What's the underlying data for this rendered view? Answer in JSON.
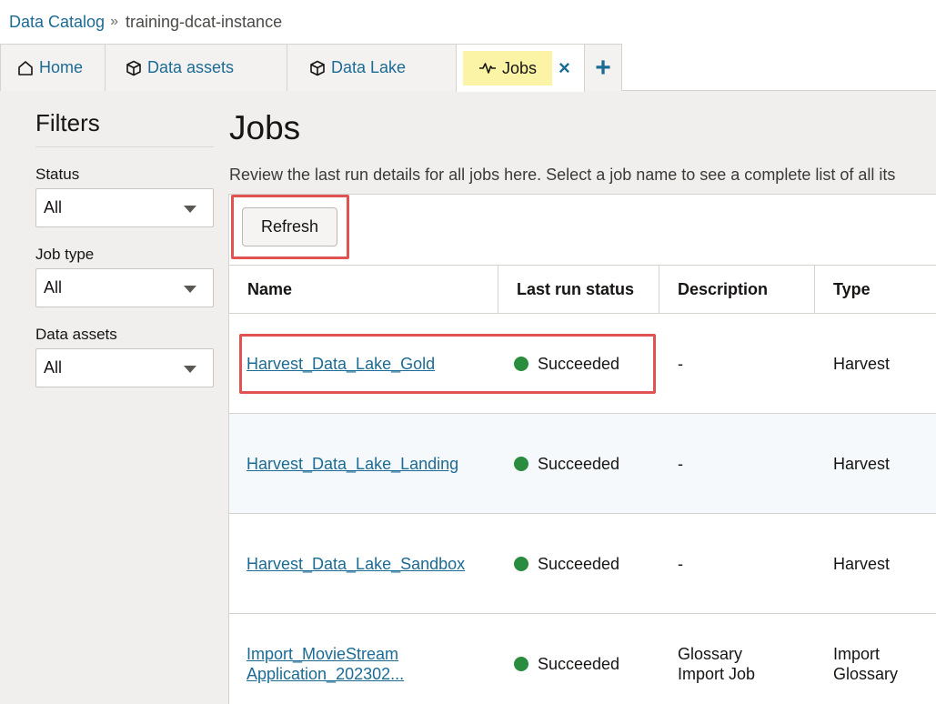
{
  "breadcrumb": {
    "root": "Data Catalog",
    "separator": "»",
    "current": "training-dcat-instance"
  },
  "tabs": {
    "home": "Home",
    "data_assets": "Data assets",
    "data_lake": "Data Lake",
    "jobs": "Jobs",
    "close_glyph": "×",
    "add_glyph": "+"
  },
  "filters": {
    "title": "Filters",
    "status_label": "Status",
    "status_value": "All",
    "job_type_label": "Job type",
    "job_type_value": "All",
    "data_assets_label": "Data assets",
    "data_assets_value": "All"
  },
  "main": {
    "title": "Jobs",
    "description": "Review the last run details for all jobs here. Select a job name to see a complete list of all its",
    "refresh_label": "Refresh"
  },
  "table": {
    "columns": [
      "Name",
      "Last run status",
      "Description",
      "Type"
    ],
    "rows": [
      {
        "name": "Harvest_Data_Lake_Gold",
        "status": "Succeeded",
        "description": "-",
        "type": "Harvest"
      },
      {
        "name": "Harvest_Data_Lake_Landing",
        "status": "Succeeded",
        "description": "-",
        "type": "Harvest"
      },
      {
        "name": "Harvest_Data_Lake_Sandbox",
        "status": "Succeeded",
        "description": "-",
        "type": "Harvest"
      },
      {
        "name_line1": "Import_MovieStream",
        "name_line2": "Application_202302...",
        "status": "Succeeded",
        "description_line1": "Glossary",
        "description_line2": "Import Job",
        "type_line1": "Import",
        "type_line2": "Glossary"
      }
    ]
  },
  "colors": {
    "link": "#1c6b94",
    "active_tab": "#fbf3a6",
    "success": "#2a8c3f",
    "highlight": "#e15252"
  }
}
